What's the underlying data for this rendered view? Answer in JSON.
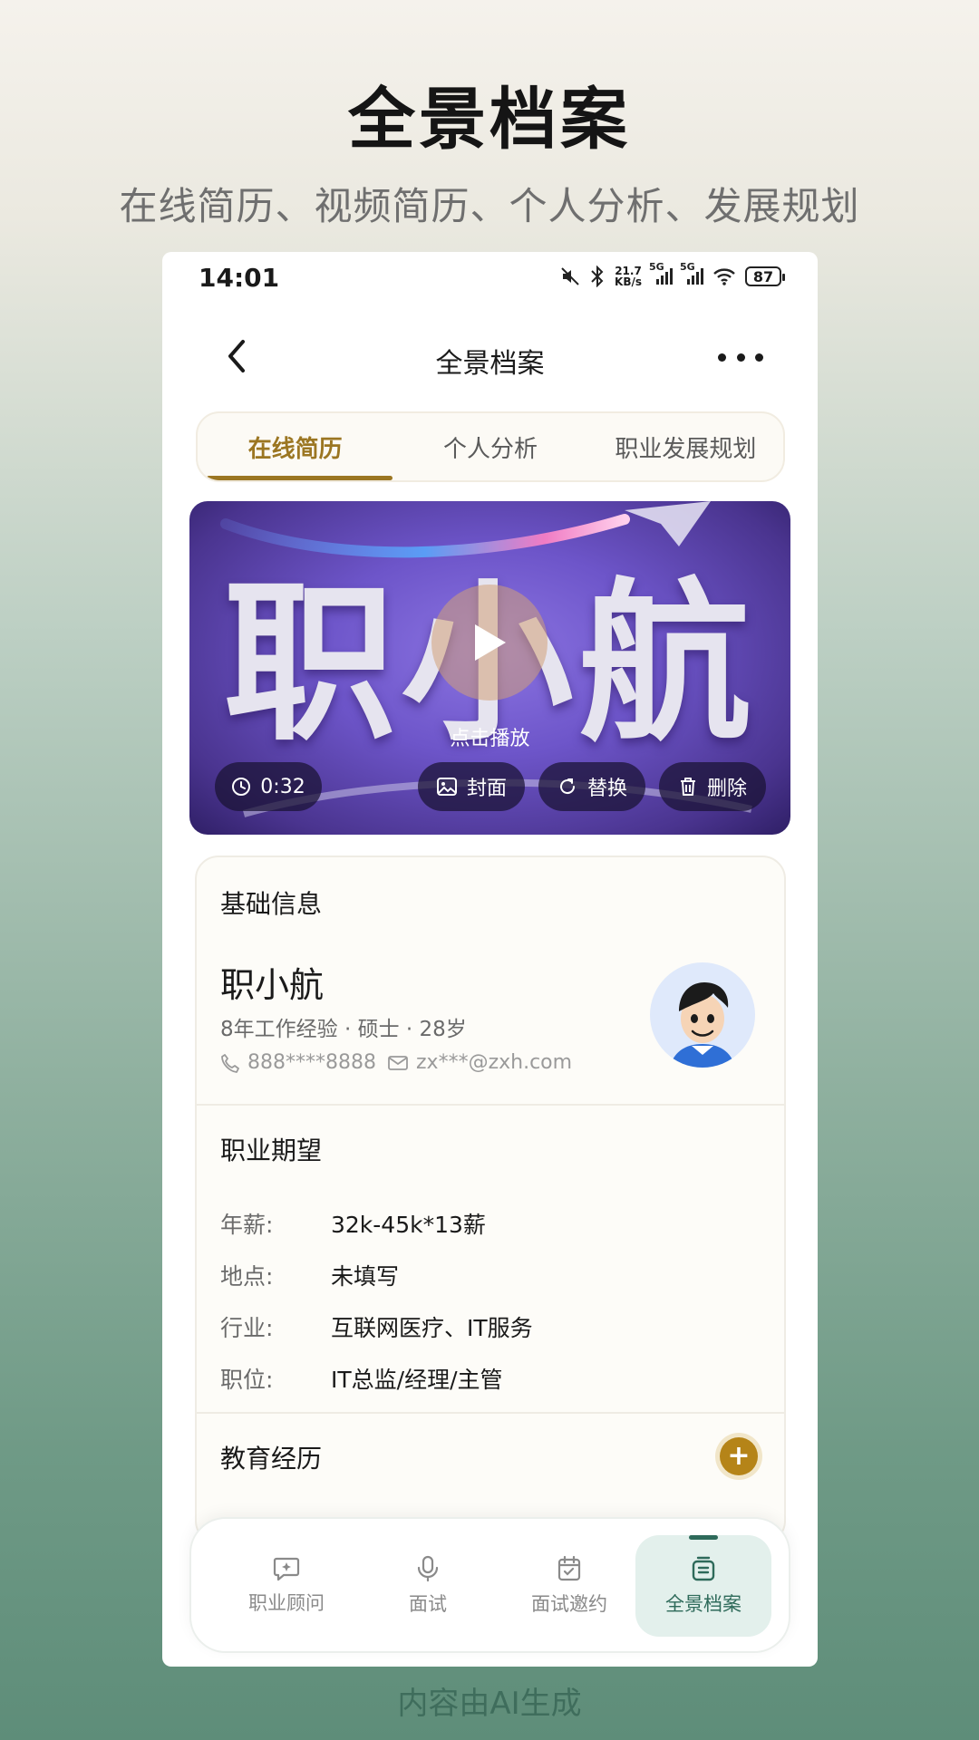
{
  "promo": {
    "title": "全景档案",
    "subtitle": "在线简历、视频简历、个人分析、发展规划",
    "footer": "内容由AI生成"
  },
  "status_bar": {
    "time": "14:01",
    "speed_value": "21.7",
    "speed_unit": "KB/s",
    "signal1": "5G",
    "signal2": "5G",
    "battery": "87",
    "icons": [
      "mute-icon",
      "bluetooth-icon",
      "signal-icon",
      "wifi-icon",
      "battery-icon"
    ]
  },
  "nav": {
    "title": "全景档案",
    "back_icon": "chevron-left-icon",
    "more_icon": "more-icon"
  },
  "tabs": [
    {
      "label": "在线简历",
      "active": true
    },
    {
      "label": "个人分析",
      "active": false
    },
    {
      "label": "职业发展规划",
      "active": false
    }
  ],
  "video": {
    "brand_text": "职小航",
    "play_hint": "点击播放",
    "duration": "0:32",
    "actions": {
      "cover": "封面",
      "replace": "替换",
      "delete": "删除"
    }
  },
  "basic_info": {
    "section_title": "基础信息",
    "name": "职小航",
    "meta": "8年工作经验 · 硕士 · 28岁",
    "phone": "888****8888",
    "email": "zx***@zxh.com"
  },
  "expectation": {
    "section_title": "职业期望",
    "rows": [
      {
        "key": "年薪:",
        "value": "32k-45k*13薪"
      },
      {
        "key": "地点:",
        "value": "未填写"
      },
      {
        "key": "行业:",
        "value": "互联网医疗、IT服务"
      },
      {
        "key": "职位:",
        "value": "IT总监/经理/主管"
      }
    ]
  },
  "education": {
    "section_title": "教育经历",
    "add_symbol": "+"
  },
  "bottom_nav": [
    {
      "label": "职业顾问",
      "icon": "chat-icon",
      "active": false
    },
    {
      "label": "面试",
      "icon": "microphone-icon",
      "active": false
    },
    {
      "label": "面试邀约",
      "icon": "calendar-icon",
      "active": false
    },
    {
      "label": "全景档案",
      "icon": "folder-icon",
      "active": true
    }
  ],
  "colors": {
    "accent_gold": "#9b7622",
    "accent_green": "#2e6a5a",
    "video_purple": "#6d55c9"
  }
}
